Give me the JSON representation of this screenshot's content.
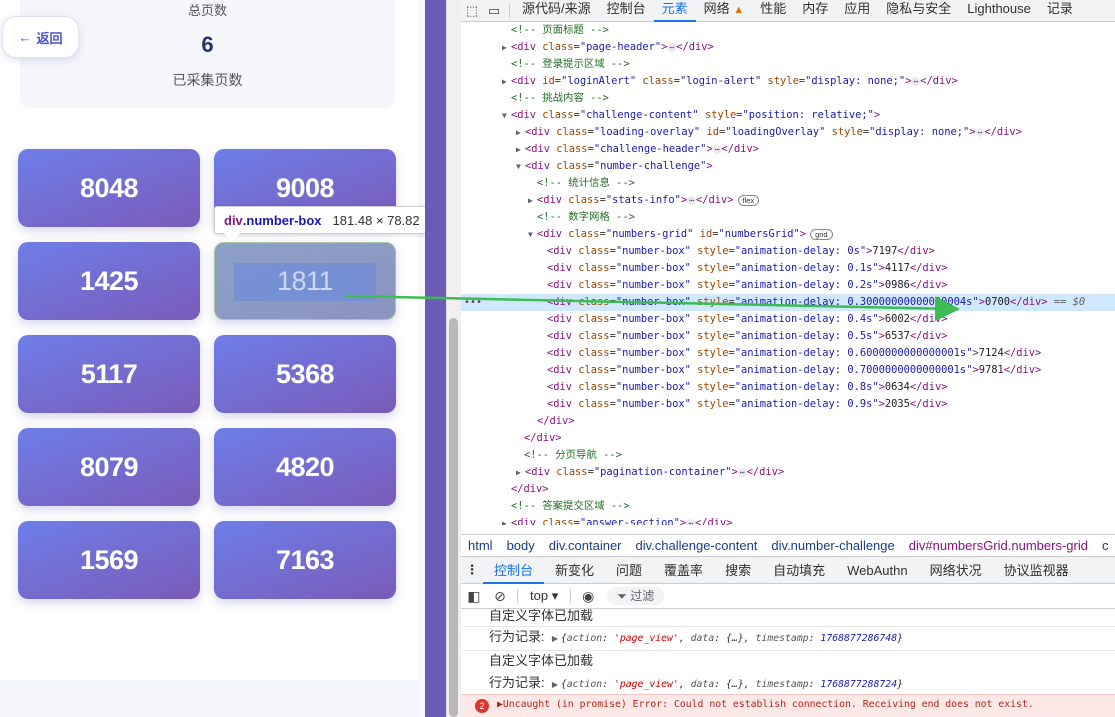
{
  "page": {
    "stats_label_top": "总页数",
    "stats_value": "6",
    "stats_label": "已采集页数",
    "back_label": "返回",
    "back_arrow": "←",
    "numbers": [
      "8048",
      "9008",
      "1425",
      "1811",
      "5117",
      "5368",
      "8079",
      "4820",
      "1569",
      "7163"
    ],
    "highlighted_index": 3
  },
  "inspect_tooltip": {
    "tag": "div",
    "cls": ".number-box",
    "dims": "181.48 × 78.82"
  },
  "devtools": {
    "tabs": [
      "源代码/来源",
      "控制台",
      "元素",
      "网络",
      "性能",
      "内存",
      "应用",
      "隐私与安全",
      "Lighthouse",
      "记录"
    ],
    "active_tab": "元素",
    "warn_tab": "网络",
    "accent_color": "#1a73e8",
    "breadcrumb": [
      "html",
      "body",
      "div.container",
      "div.challenge-content",
      "div.number-challenge",
      "div#numbersGrid.numbers-grid",
      "c"
    ],
    "drawer_tabs": [
      "控制台",
      "新变化",
      "问题",
      "覆盖率",
      "搜索",
      "自动填充",
      "WebAuthn",
      "网络状况",
      "协议监视器"
    ],
    "console_context": "top",
    "filter_placeholder": "过滤",
    "console": {
      "font_loaded_1": "自定义字体已加载",
      "behavior_label_1": "行为记录:",
      "obj_1": {
        "action": "'page_view'",
        "timestamp": "1768877286748"
      },
      "font_loaded_2": "自定义字体已加载",
      "behavior_label_2": "行为记录:",
      "obj_2": {
        "action": "'page_view'",
        "timestamp": "1768877288724"
      },
      "error_count": "2",
      "error_text": "Uncaught (in promise) Error: Could not establish connection. Receiving end does not exist."
    },
    "dom": {
      "c_page_title": "<!-- 页面标题 -->",
      "c_login": "<!-- 登录提示区域 -->",
      "c_challenge": "<!-- 挑战内容 -->",
      "c_stats": "<!-- 统计信息 -->",
      "c_grid": "<!-- 数字网格 -->",
      "c_pagination": "<!-- 分页导航 -->",
      "c_answer": "<!-- 答案提交区域 -->",
      "box_values": [
        "7197",
        "4117",
        "0986",
        "0700",
        "6002",
        "6537",
        "7124",
        "9781",
        "0634",
        "2035"
      ],
      "box_delays": [
        "0s",
        "0.1s",
        "0.2s",
        "",
        "0.4s",
        "0.5s",
        "0.6000000000000001s",
        "0.7000000000000001s",
        "0.8s",
        "0.9s"
      ],
      "selected_marker": "== $0",
      "badge_flex": "flex",
      "badge_grid": "grid"
    }
  }
}
